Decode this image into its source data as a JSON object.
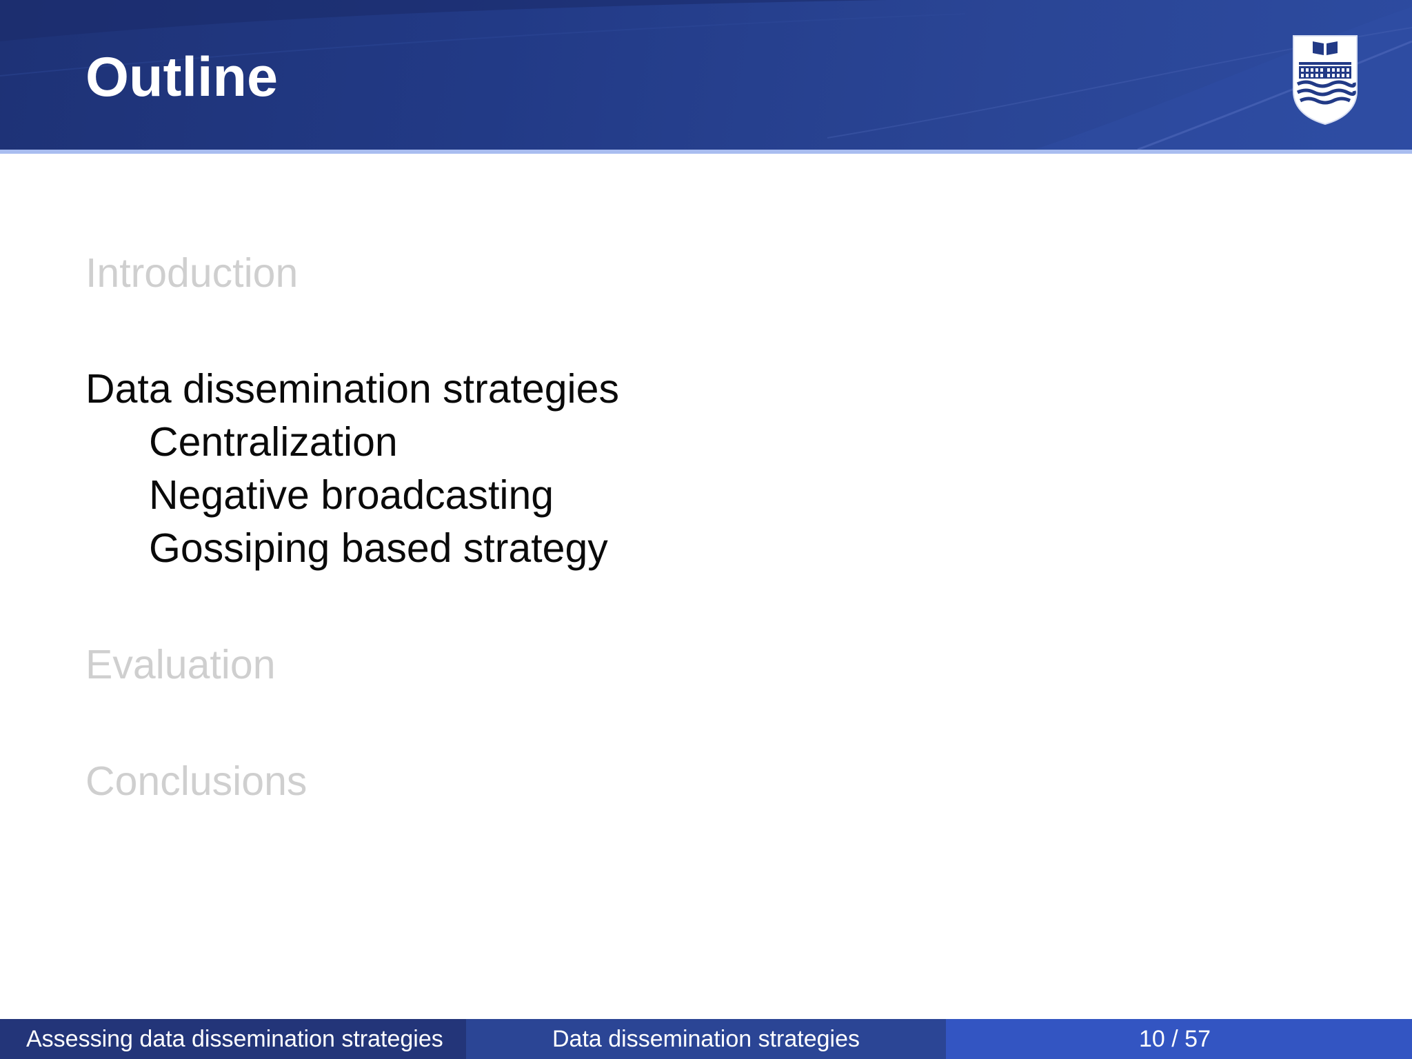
{
  "slide": {
    "title": "Outline",
    "logo_icon": "university-shield-logo-icon"
  },
  "toc": {
    "sections": [
      {
        "label": "Introduction",
        "state": "dimmed"
      },
      {
        "label": "Data dissemination strategies",
        "state": "current",
        "subsections": [
          "Centralization",
          "Negative broadcasting",
          "Gossiping based strategy"
        ]
      },
      {
        "label": "Evaluation",
        "state": "dimmed"
      },
      {
        "label": "Conclusions",
        "state": "dimmed"
      }
    ]
  },
  "footer": {
    "presentation_title": "Assessing data dissemination strategies",
    "current_section": "Data dissemination strategies",
    "page": "10 / 57"
  },
  "colors": {
    "header_blue": "#223a86",
    "header_rule": "#a9bdf0",
    "dim_text": "#cfcfcf",
    "active_text": "#0a0a0a",
    "footer_left": "#233579",
    "footer_mid": "#2b4595",
    "footer_right": "#3355c2"
  }
}
